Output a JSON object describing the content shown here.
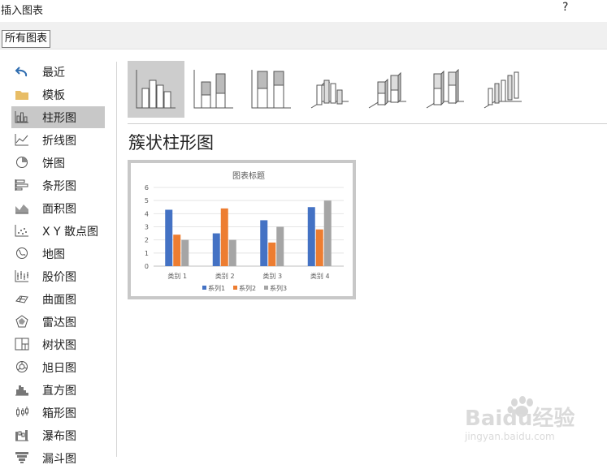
{
  "dialog": {
    "title": "插入图表",
    "help_label": "?"
  },
  "tabs": [
    {
      "label": "所有图表"
    }
  ],
  "sidebar": {
    "selected_index": 2,
    "items": [
      {
        "label": "最近",
        "icon": "undo-arrow-icon"
      },
      {
        "label": "模板",
        "icon": "folder-icon"
      },
      {
        "label": "柱形图",
        "icon": "column-chart-icon"
      },
      {
        "label": "折线图",
        "icon": "line-chart-icon"
      },
      {
        "label": "饼图",
        "icon": "pie-chart-icon"
      },
      {
        "label": "条形图",
        "icon": "bar-chart-icon"
      },
      {
        "label": "面积图",
        "icon": "area-chart-icon"
      },
      {
        "label": "X Y 散点图",
        "icon": "scatter-chart-icon"
      },
      {
        "label": "地图",
        "icon": "globe-icon"
      },
      {
        "label": "股价图",
        "icon": "stock-chart-icon"
      },
      {
        "label": "曲面图",
        "icon": "surface-chart-icon"
      },
      {
        "label": "雷达图",
        "icon": "radar-chart-icon"
      },
      {
        "label": "树状图",
        "icon": "treemap-chart-icon"
      },
      {
        "label": "旭日图",
        "icon": "sunburst-chart-icon"
      },
      {
        "label": "直方图",
        "icon": "histogram-chart-icon"
      },
      {
        "label": "箱形图",
        "icon": "box-whisker-chart-icon"
      },
      {
        "label": "瀑布图",
        "icon": "waterfall-chart-icon"
      },
      {
        "label": "漏斗图",
        "icon": "funnel-chart-icon"
      }
    ]
  },
  "subtypes": {
    "selected_index": 0,
    "items": [
      {
        "icon": "clustered-column-icon"
      },
      {
        "icon": "stacked-column-icon"
      },
      {
        "icon": "100-percent-stacked-column-icon"
      },
      {
        "icon": "3d-clustered-column-icon"
      },
      {
        "icon": "3d-stacked-column-icon"
      },
      {
        "icon": "3d-100-percent-stacked-column-icon"
      },
      {
        "icon": "3d-column-icon"
      }
    ]
  },
  "chart_type_name": "簇状柱形图",
  "watermark": {
    "brand": "Baidu经验",
    "url": "jingyan.baidu.com"
  },
  "chart_data": {
    "type": "bar",
    "title": "图表标题",
    "categories": [
      "类别 1",
      "类别 2",
      "类别 3",
      "类别 4"
    ],
    "series": [
      {
        "name": "系列1",
        "values": [
          4.3,
          2.5,
          3.5,
          4.5
        ],
        "color": "#4472c4"
      },
      {
        "name": "系列2",
        "values": [
          2.4,
          4.4,
          1.8,
          2.8
        ],
        "color": "#ed7d31"
      },
      {
        "name": "系列3",
        "values": [
          2,
          2,
          3,
          5
        ],
        "color": "#a5a5a5"
      }
    ],
    "ylim": [
      0,
      6
    ],
    "yticks": [
      0,
      1,
      2,
      3,
      4,
      5,
      6
    ],
    "grid": true,
    "legend_position": "bottom"
  }
}
